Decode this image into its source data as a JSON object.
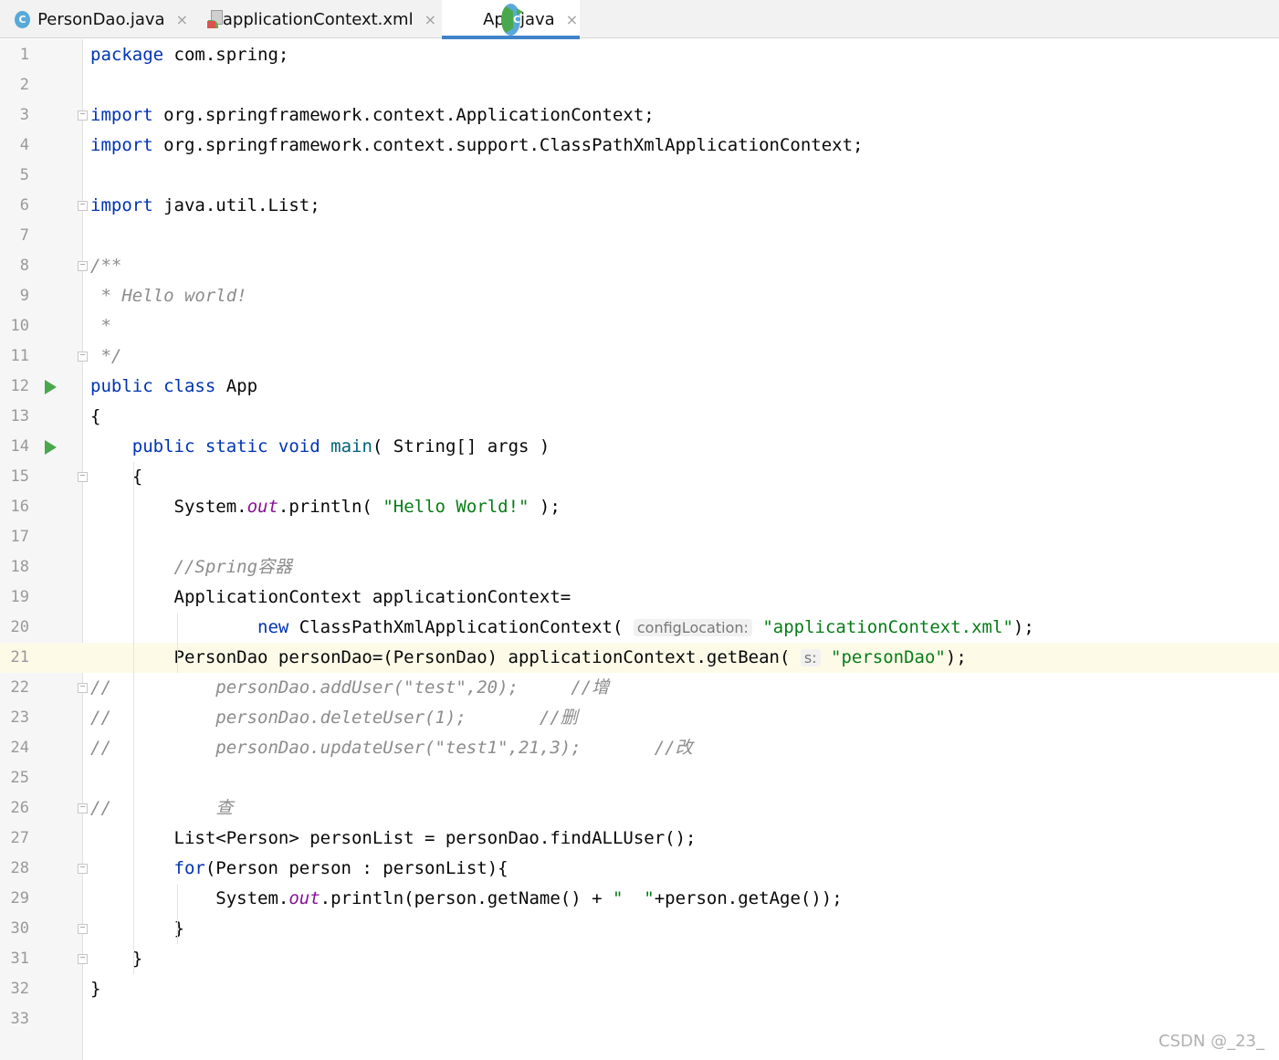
{
  "tabs": [
    {
      "label": "PersonDao.java",
      "icon": "java-class-icon",
      "close": "×"
    },
    {
      "label": "applicationContext.xml",
      "icon": "xml-file-icon",
      "close": "×"
    },
    {
      "label": "App.java",
      "icon": "java-class-runnable-icon",
      "close": "×",
      "active": true
    }
  ],
  "lines": [
    {
      "n": "1",
      "html": "<span class=\"kw\">package</span> com.spring;"
    },
    {
      "n": "2",
      "html": ""
    },
    {
      "n": "3",
      "html": "<span class=\"kw\">import</span> org.springframework.context.ApplicationContext;"
    },
    {
      "n": "4",
      "html": "<span class=\"kw\">import</span> org.springframework.context.support.ClassPathXmlApplicationContext;"
    },
    {
      "n": "5",
      "html": ""
    },
    {
      "n": "6",
      "html": "<span class=\"kw\">import</span> java.util.List;"
    },
    {
      "n": "7",
      "html": ""
    },
    {
      "n": "8",
      "html": "<span class=\"cmt\">/**</span>"
    },
    {
      "n": "9",
      "html": "<span class=\"cmt\"> * Hello world!</span>"
    },
    {
      "n": "10",
      "html": "<span class=\"cmt\"> *</span>"
    },
    {
      "n": "11",
      "html": "<span class=\"cmt\"> */</span>"
    },
    {
      "n": "12",
      "html": "<span class=\"kw\">public class</span> App"
    },
    {
      "n": "13",
      "html": "{"
    },
    {
      "n": "14",
      "html": "    <span class=\"kw\">public static void</span> <span style=\"color:#00627a\">main</span>( String[] args )"
    },
    {
      "n": "15",
      "html": "    {"
    },
    {
      "n": "16",
      "html": "        System.<span class=\"fld\">out</span>.println( <span class=\"str\">\"Hello World!\"</span> );"
    },
    {
      "n": "17",
      "html": ""
    },
    {
      "n": "18",
      "html": "        <span class=\"cmt\">//Spring容器</span>"
    },
    {
      "n": "19",
      "html": "        ApplicationContext applicationContext="
    },
    {
      "n": "20",
      "html": "                <span class=\"kw\">new</span> ClassPathXmlApplicationContext( <span class=\"hint\">configLocation:</span> <span class=\"str\">\"applicationContext.xml\"</span>);"
    },
    {
      "n": "21",
      "html": "        PersonDao personDao=(PersonDao) applicationContext.getBean( <span class=\"hint\">s:</span> <span class=\"str\">\"personDao\"</span>);"
    },
    {
      "n": "22",
      "html": "<span class=\"cmt\">//          personDao.addUser(\"test\",20);     //增</span>"
    },
    {
      "n": "23",
      "html": "<span class=\"cmt\">//          personDao.deleteUser(1);       //删</span>"
    },
    {
      "n": "24",
      "html": "<span class=\"cmt\">//          personDao.updateUser(\"test1\",21,3);       //改</span>"
    },
    {
      "n": "25",
      "html": ""
    },
    {
      "n": "26",
      "html": "<span class=\"cmt\">//          查</span>"
    },
    {
      "n": "27",
      "html": "        List&lt;Person&gt; personList = personDao.findALLUser();"
    },
    {
      "n": "28",
      "html": "        <span class=\"kw\">for</span>(Person person : personList){"
    },
    {
      "n": "29",
      "html": "            System.<span class=\"fld\">out</span>.println(person.getName() + <span class=\"str\">\"  \"</span>+person.getAge());"
    },
    {
      "n": "30",
      "html": "        }"
    },
    {
      "n": "31",
      "html": "    }"
    },
    {
      "n": "32",
      "html": "}"
    },
    {
      "n": "33",
      "html": ""
    }
  ],
  "watermark": "CSDN @_23_",
  "colors": {
    "keyword": "#0033b3",
    "string": "#067d17",
    "comment": "#8c8c8c",
    "field": "#871094",
    "current_line": "#fdfbe8",
    "tab_underline": "#4083c9"
  }
}
